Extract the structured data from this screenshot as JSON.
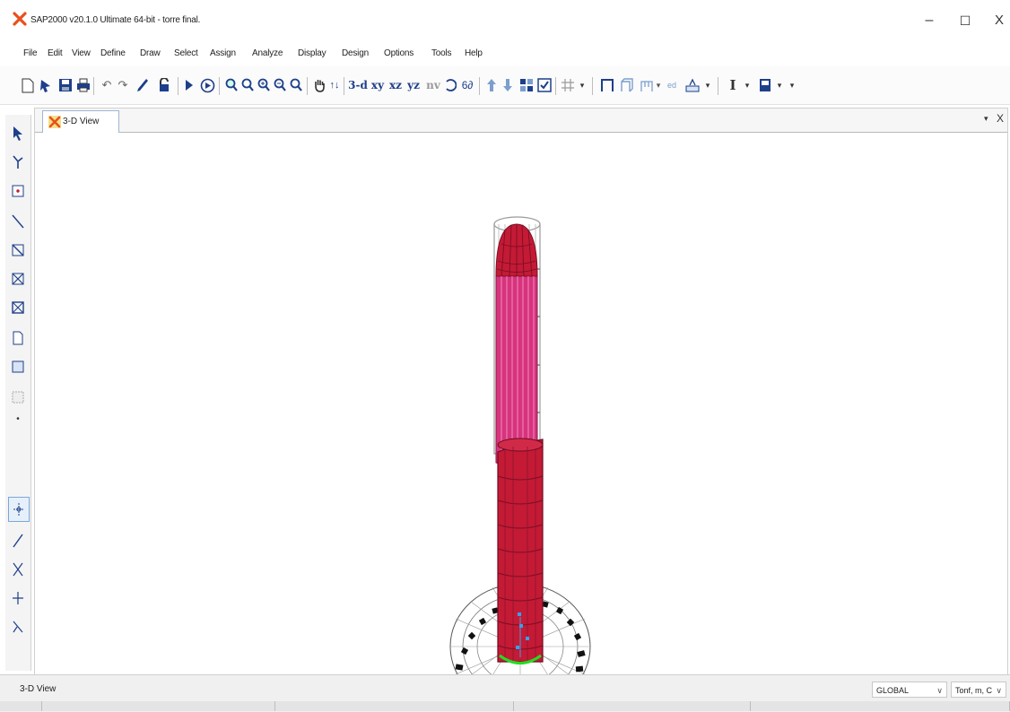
{
  "window": {
    "title": "SAP2000 v20.1.0 Ultimate 64-bit - torre final.",
    "minimize_label": "–",
    "maximize_label": "☐",
    "close_label": "X",
    "logo_icon": "sap2000-logo-icon"
  },
  "menu": {
    "items": [
      "File",
      "Edit",
      "View",
      "Define",
      "Draw",
      "Select",
      "Assign",
      "Analyze",
      "Display",
      "Design",
      "Options",
      "Tools",
      "Help"
    ]
  },
  "toolbar": {
    "text_buttons": {
      "view_3d": "3-d",
      "view_xy": "xy",
      "view_xz": "xz",
      "view_yz": "yz",
      "view_nv": "nv",
      "set_display": "I"
    }
  },
  "tab": {
    "label": "3-D View",
    "dropdown": "▾",
    "close": "X"
  },
  "status": {
    "view_name": "3-D View",
    "coord_system": "GLOBAL",
    "units": "Tonf, m, C"
  },
  "colors": {
    "structure_red": "#c41a35",
    "structure_pink": "#d7337e",
    "grid_gray": "#9a9a9a",
    "support_green": "#22dd22",
    "accent_blue": "#1e3f8a"
  }
}
